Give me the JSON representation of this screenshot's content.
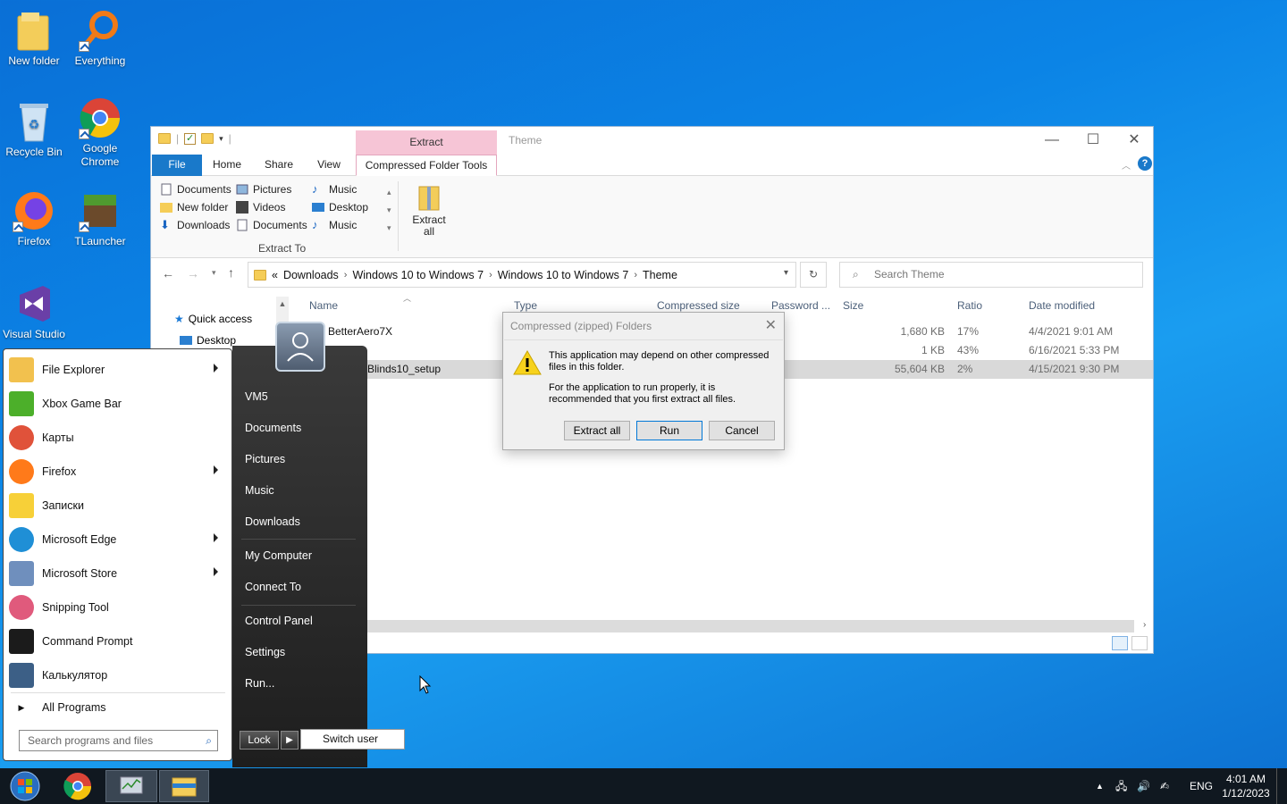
{
  "desktop": {
    "icons": [
      {
        "label": "New folder"
      },
      {
        "label": "Everything"
      },
      {
        "label": "Recycle Bin"
      },
      {
        "label": "Google Chrome"
      },
      {
        "label": "Firefox"
      },
      {
        "label": "TLauncher"
      },
      {
        "label": "Visual Studio"
      }
    ]
  },
  "explorer": {
    "title": "Theme",
    "context_tab": "Extract",
    "tabs": [
      "File",
      "Home",
      "Share",
      "View",
      "Compressed Folder Tools"
    ],
    "ribbon": {
      "extract_to": [
        [
          "Documents",
          "Pictures",
          "Music"
        ],
        [
          "New folder",
          "Videos",
          "Desktop"
        ],
        [
          "Downloads",
          "Documents",
          "Music"
        ]
      ],
      "group_label": "Extract To",
      "extract_all": "Extract all"
    },
    "breadcrumb": [
      "Downloads",
      "Windows 10 to Windows 7",
      "Windows 10 to Windows 7",
      "Theme"
    ],
    "breadcrumb_prefix": "«",
    "search_placeholder": "Search Theme",
    "nav": {
      "quick_access": "Quick access",
      "desktop": "Desktop"
    },
    "columns": {
      "name": "Name",
      "type": "Type",
      "compressed": "Compressed size",
      "password": "Password ...",
      "size": "Size",
      "ratio": "Ratio",
      "date": "Date modified"
    },
    "rows": [
      {
        "name": "BetterAero7X",
        "size": "1,680 KB",
        "ratio": "17%",
        "date": "4/4/2021 9:01 AM"
      },
      {
        "name": "",
        "size": "1 KB",
        "ratio": "43%",
        "date": "6/16/2021 5:33 PM"
      },
      {
        "name": "Blinds10_setup",
        "size": "55,604 KB",
        "ratio": "2%",
        "date": "4/15/2021 9:30 PM"
      }
    ]
  },
  "dialog": {
    "title": "Compressed (zipped) Folders",
    "message1": "This application may depend on other compressed files in this folder.",
    "message2": "For the application to run properly, it is recommended that you first extract all files.",
    "buttons": {
      "extract_all": "Extract all",
      "run": "Run",
      "cancel": "Cancel"
    }
  },
  "start_menu": {
    "programs": [
      {
        "label": "File Explorer",
        "color": "#f2c14e"
      },
      {
        "label": "Xbox Game Bar",
        "color": "#4caf2a"
      },
      {
        "label": "Карты",
        "color": "#e0523a"
      },
      {
        "label": "Firefox",
        "color": "#ff7a1a"
      },
      {
        "label": "Записки",
        "color": "#f7d038"
      },
      {
        "label": "Microsoft Edge",
        "color": "#1f8fd6"
      },
      {
        "label": "Microsoft Store",
        "color": "#6f8fbd"
      },
      {
        "label": "Snipping Tool",
        "color": "#e05a7c"
      },
      {
        "label": "Command Prompt",
        "color": "#1b1b1b"
      },
      {
        "label": "Калькулятор",
        "color": "#3c5f86"
      }
    ],
    "all_programs": "All Programs",
    "search_placeholder": "Search programs and files",
    "right_links": [
      "VM5",
      "Documents",
      "Pictures",
      "Music",
      "Downloads",
      "My Computer",
      "Connect To",
      "Control Panel",
      "Settings",
      "Run..."
    ],
    "lock": "Lock",
    "switch_user": "Switch user"
  },
  "taskbar": {
    "lang": "ENG",
    "time": "4:01 AM",
    "date": "1/12/2023"
  }
}
